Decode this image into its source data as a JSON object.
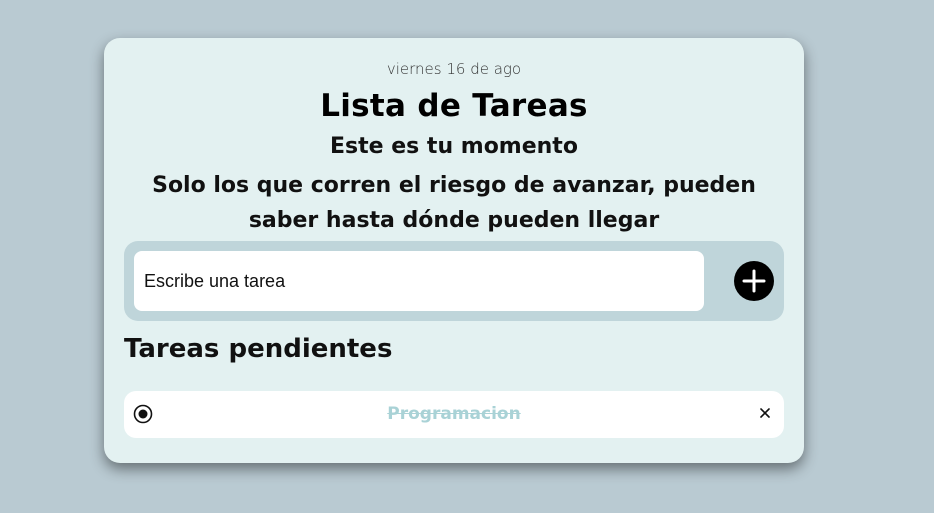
{
  "header": {
    "date": "viernes 16 de ago",
    "title": "Lista de Tareas",
    "subtitle": "Este es tu momento",
    "quote": "Solo los que corren el riesgo de avanzar, pueden saber hasta dónde pueden llegar"
  },
  "input": {
    "placeholder": "Escribe una tarea",
    "value": "",
    "add_icon": "plus-circle-icon"
  },
  "pending": {
    "title": "Tareas pendientes",
    "tasks": [
      {
        "text": "Programacion",
        "done": true,
        "check_icon": "radio-checked-icon",
        "delete_icon": "close-icon"
      }
    ]
  },
  "colors": {
    "background": "#b9cad2",
    "card": "#e3f1f1",
    "input_bar": "#bfd5da",
    "done_text": "#a9d2d6",
    "accent": "#000000"
  }
}
